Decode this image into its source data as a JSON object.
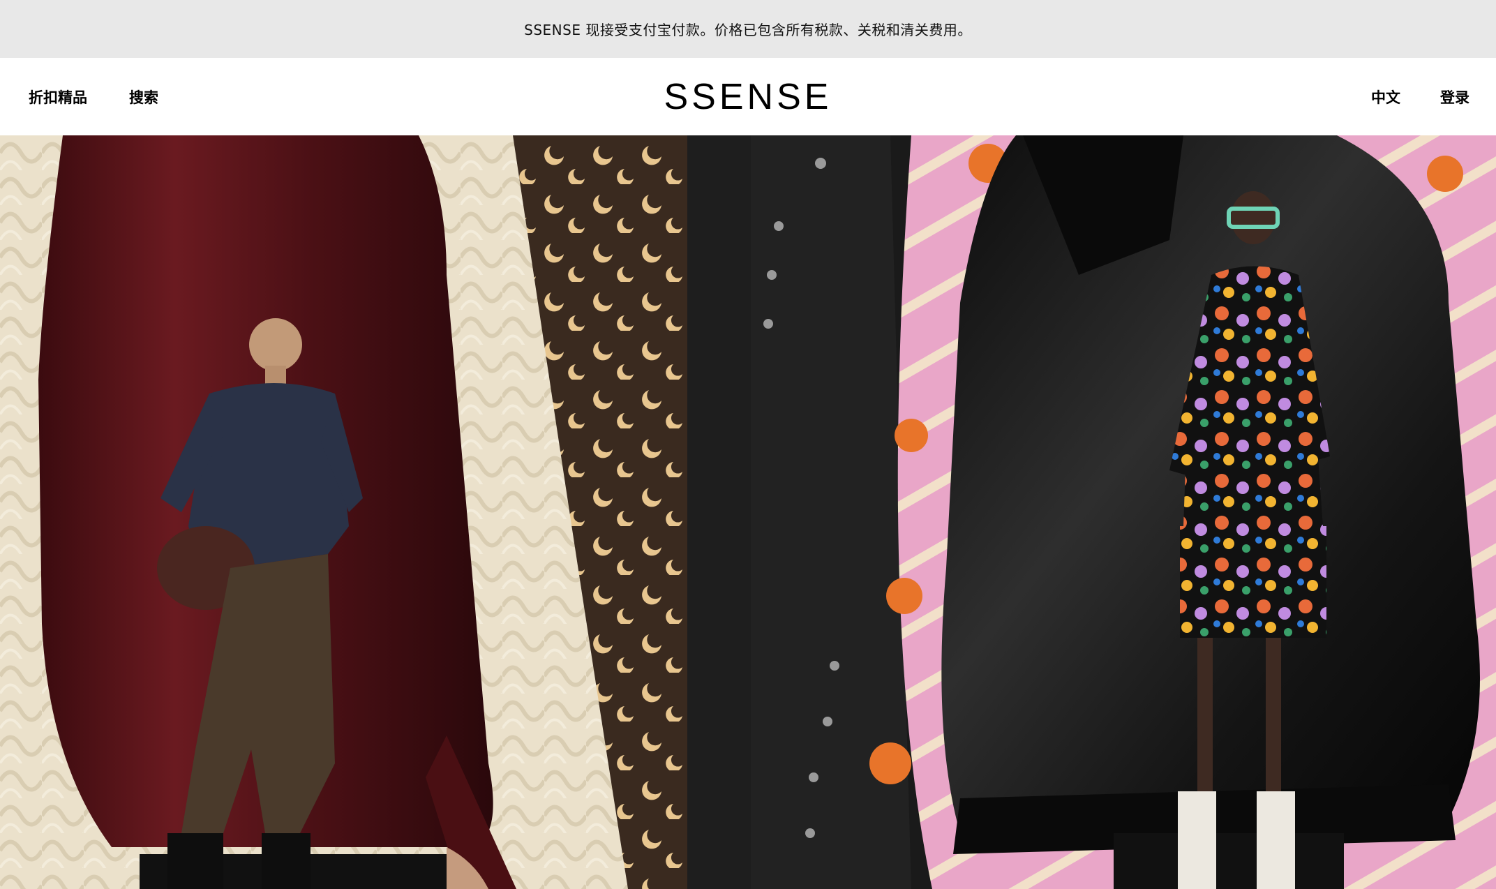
{
  "announcement": {
    "text": "SSENSE 现接受支付宝付款。价格已包含所有税款、关税和清关费用。"
  },
  "nav": {
    "sale_label": "折扣精品",
    "search_label": "搜索",
    "logo_text": "SSENSE",
    "language_label": "中文",
    "login_label": "登录"
  },
  "hero": {
    "left_panel": {
      "depicts": [
        "cream-cable-knit-sweater",
        "burgundy-velvet-blazer",
        "male-model-navy-henley",
        "moon-print-top"
      ]
    },
    "right_panel": {
      "depicts": [
        "black-studded-leather-jacket",
        "pink-knit-cardigan-flower-appliques",
        "black-shearling-leather-jacket",
        "female-model-floral-dress"
      ]
    }
  },
  "colors": {
    "announcement_bg": "#e8e8e8",
    "nav_bg": "#ffffff",
    "text": "#000000"
  }
}
